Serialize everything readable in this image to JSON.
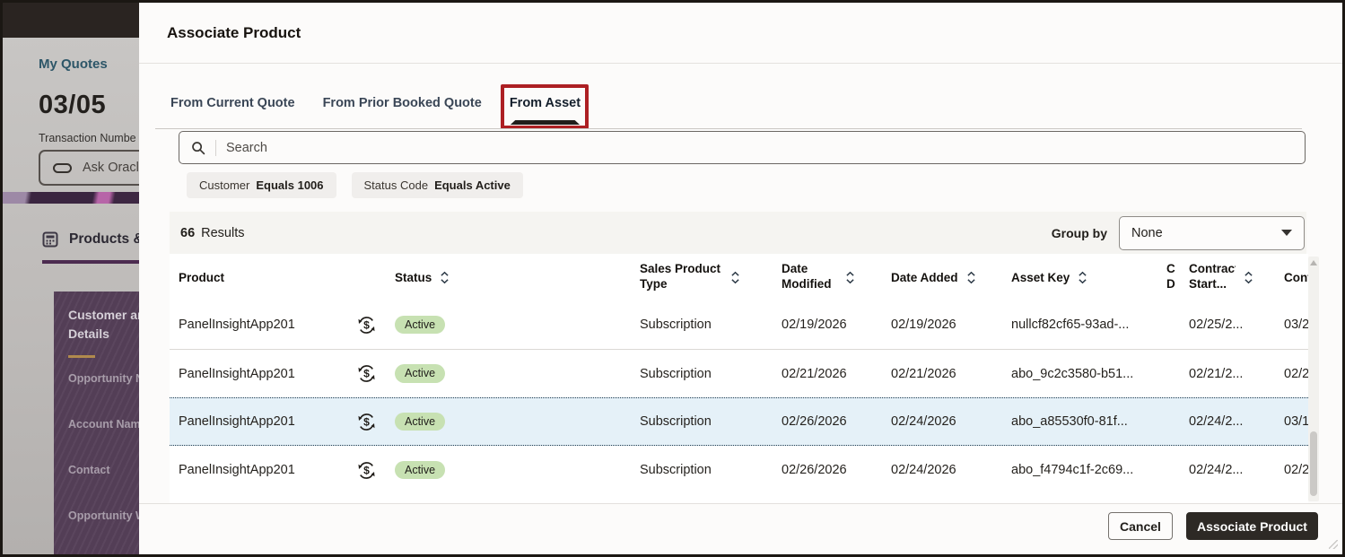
{
  "background": {
    "my_quotes": "My Quotes",
    "date": "03/05",
    "transaction_label": "Transaction Numbe",
    "ask_placeholder": "Ask Oracl",
    "products_tab": "Products & P",
    "panel": {
      "title_line1": "Customer an",
      "title_line2": "Details",
      "items": [
        {
          "label": "Opportunity N"
        },
        {
          "label": "Account Name"
        },
        {
          "label": "Contact"
        },
        {
          "label": "Opportunity W"
        }
      ]
    }
  },
  "modal": {
    "title": "Associate Product",
    "tabs": [
      {
        "label": "From Current Quote",
        "active": false
      },
      {
        "label": "From Prior Booked Quote",
        "active": false
      },
      {
        "label": "From Asset",
        "active": true
      }
    ],
    "search": {
      "placeholder": "Search"
    },
    "filters": [
      {
        "label": "Customer",
        "value": "Equals 1006"
      },
      {
        "label": "Status Code",
        "value": "Equals Active"
      }
    ],
    "results": {
      "count": "66",
      "label": "Results"
    },
    "group_by": {
      "label": "Group by",
      "value": "None"
    },
    "table": {
      "columns": [
        {
          "label": "Product",
          "sortable": false
        },
        {
          "label": "",
          "sortable": false
        },
        {
          "label": "Status",
          "sortable": true
        },
        {
          "label": "Sales Product Type",
          "sortable": true
        },
        {
          "label": "Date Modified",
          "sortable": true
        },
        {
          "label": "Date Added",
          "sortable": true
        },
        {
          "label": "Asset Key",
          "sortable": true
        },
        {
          "label": "C D",
          "sortable": false
        },
        {
          "label": "Contract Start...",
          "sortable": true
        },
        {
          "label": "Cont",
          "sortable": false
        }
      ],
      "rows": [
        {
          "product": "PanelInsightApp201",
          "status": "Active",
          "type": "Subscription",
          "date_modified": "02/19/2026",
          "date_added": "02/19/2026",
          "asset_key": "nullcf82cf65-93ad-...",
          "contract_start": "02/25/2...",
          "cont": "03/2",
          "selected": false
        },
        {
          "product": "PanelInsightApp201",
          "status": "Active",
          "type": "Subscription",
          "date_modified": "02/21/2026",
          "date_added": "02/21/2026",
          "asset_key": "abo_9c2c3580-b51...",
          "contract_start": "02/21/2...",
          "cont": "02/2",
          "selected": false
        },
        {
          "product": "PanelInsightApp201",
          "status": "Active",
          "type": "Subscription",
          "date_modified": "02/26/2026",
          "date_added": "02/24/2026",
          "asset_key": "abo_a85530f0-81f...",
          "contract_start": "02/24/2...",
          "cont": "03/1",
          "selected": true
        },
        {
          "product": "PanelInsightApp201",
          "status": "Active",
          "type": "Subscription",
          "date_modified": "02/26/2026",
          "date_added": "02/24/2026",
          "asset_key": "abo_f4794c1f-2c69...",
          "contract_start": "02/24/2...",
          "cont": "02/2",
          "selected": false
        }
      ]
    },
    "footer": {
      "cancel_label": "Cancel",
      "primary_label": "Associate Product"
    }
  },
  "colors": {
    "annotation_red": "#ad1f23",
    "badge_green": "#c7e1b2",
    "selected_row": "#e5f1f8",
    "primary_button": "#2d2925",
    "panel_purple": "#564059",
    "results_bar": "#f5f4f1"
  }
}
